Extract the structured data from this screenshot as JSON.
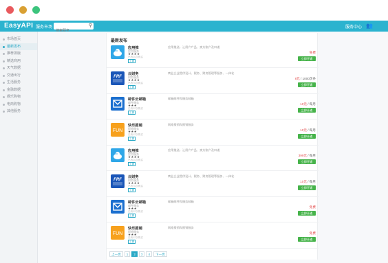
{
  "window": {
    "controls": [
      {
        "name": "close",
        "color": "#e95a5e"
      },
      {
        "name": "minimize",
        "color": "#d9a033"
      },
      {
        "name": "maximize",
        "color": "#3cc47d"
      }
    ]
  },
  "header": {
    "logo": "EasyA",
    "logo_glyph": "P",
    "logo_tail": "I",
    "market_label": "服务市场",
    "search_placeholder": "搜索服务",
    "service_center": "服务中心",
    "accent": "#2bb3cf"
  },
  "sidebar": {
    "items": [
      {
        "label": "市场首页",
        "active": false
      },
      {
        "label": "最新发布",
        "active": true
      },
      {
        "label": "推荐排版",
        "active": false
      },
      {
        "label": "精选商用",
        "active": false
      },
      {
        "label": "天气数据",
        "active": false
      },
      {
        "label": "交通出行",
        "active": false
      },
      {
        "label": "生活服务",
        "active": false
      },
      {
        "label": "金融数据",
        "active": false
      },
      {
        "label": "娱乐购物",
        "active": false
      },
      {
        "label": "电商购物",
        "active": false
      },
      {
        "label": "其他服务",
        "active": false
      }
    ]
  },
  "main": {
    "title": "最新发布",
    "rows": [
      {
        "name": "应用推",
        "vendor": "应用服务",
        "stars": "★★★★",
        "count": "已有20次购买",
        "tag": "工具",
        "desc": "应用推送，让用户产品、卖方账户及口道",
        "price": "免费",
        "unit": "",
        "button": "立即开通",
        "logo": "app-push"
      },
      {
        "name": "云财务",
        "vendor": "财务服务",
        "stars": "★★★★",
        "count": "已有70次购买",
        "tag": "工具",
        "desc": "商业企业提供设计、税务、财务管理等服务、一体化",
        "price": "8元",
        "unit": " / 1000次条",
        "button": "立即开通",
        "logo": "cloud-finance"
      },
      {
        "name": "邮件云邮箱",
        "vendor": "邮件服务",
        "stars": "★★★",
        "count": "已有22次购买",
        "tag": "工具",
        "desc": "邮箱邮件和服务邮箱",
        "price": "10元",
        "unit": " / 每月",
        "button": "立即开通",
        "logo": "mail-cloud"
      },
      {
        "name": "快乐报销",
        "vendor": "报销服务",
        "stars": "★★★",
        "count": "已有12次购买",
        "tag": "工具",
        "desc": "网络报销和报销服务",
        "price": "10元",
        "unit": " / 每月",
        "button": "立即开通",
        "logo": "fun-expense"
      },
      {
        "name": "应用推",
        "vendor": "应用服务",
        "stars": "★★★★",
        "count": "已有20次购买",
        "tag": "工具",
        "desc": "应用推送，让用户产品、卖方账户及口道",
        "price": "399元",
        "unit": " / 每月",
        "button": "立即开通",
        "logo": "app-push"
      },
      {
        "name": "云财务",
        "vendor": "财务服务",
        "stars": "★★★★",
        "count": "已有70次购买",
        "tag": "工具",
        "desc": "商业企业提供设计、税务、财务管理等服务、一体化",
        "price": "10元",
        "unit": " / 每月",
        "button": "立即开通",
        "logo": "cloud-finance"
      },
      {
        "name": "邮件云邮箱",
        "vendor": "邮件服务",
        "stars": "★★★",
        "count": "已有22次购买",
        "tag": "工具",
        "desc": "邮箱邮件和服务邮箱",
        "price": "免费",
        "unit": "",
        "button": "立即开通",
        "logo": "mail-cloud"
      },
      {
        "name": "快乐报销",
        "vendor": "报销服务",
        "stars": "★★★",
        "count": "已有12次购买",
        "tag": "工具",
        "desc": "网络报销和报销服务",
        "price": "免费",
        "unit": "",
        "button": "立即开通",
        "logo": "fun-expense"
      }
    ]
  },
  "pagination": {
    "prev": "上一页",
    "pages": [
      "1",
      "2",
      "3",
      "4"
    ],
    "active": "2",
    "next": "下一页"
  },
  "colors": {
    "price": "#e24a4a",
    "button": "#46b34a",
    "accent": "#2aa9c6"
  }
}
